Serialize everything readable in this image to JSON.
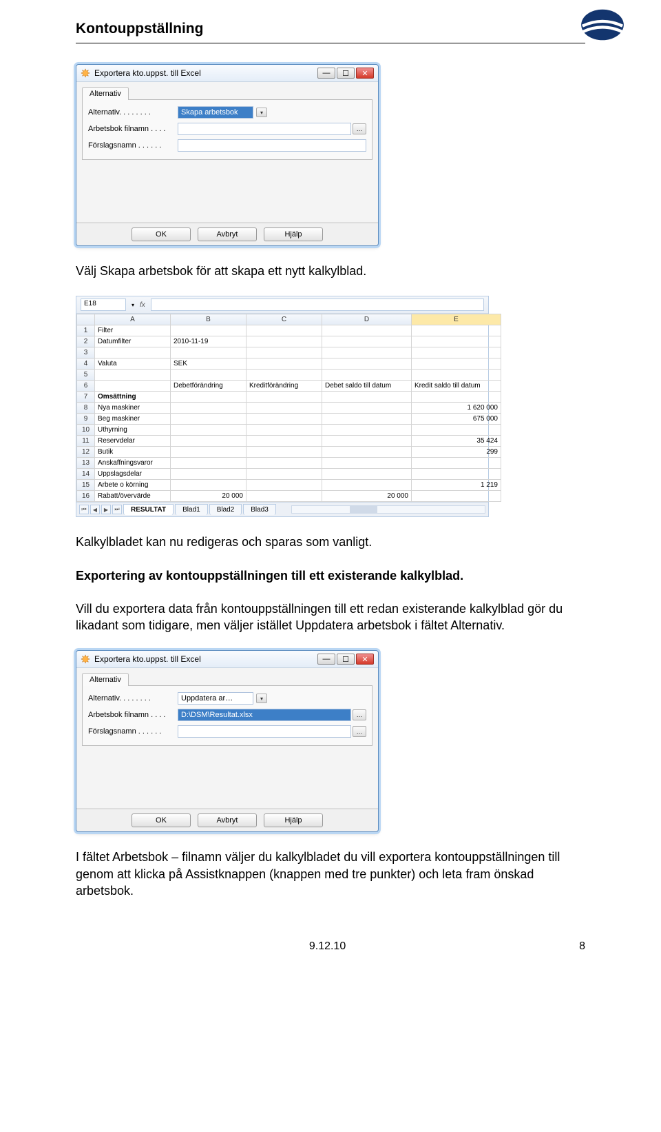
{
  "header": {
    "title": "Kontouppställning"
  },
  "dialog1": {
    "title": "Exportera kto.uppst. till Excel",
    "tab": "Alternativ",
    "rows": {
      "alt_label": "Alternativ. . . . . . . .",
      "alt_value": "Skapa arbetsbok",
      "wb_label": "Arbetsbok filnamn . . . .",
      "wb_value": "",
      "sugg_label": "Förslagsnamn . . . . . .",
      "sugg_value": ""
    },
    "buttons": {
      "ok": "OK",
      "cancel": "Avbryt",
      "help": "Hjälp"
    }
  },
  "para1": "Välj Skapa arbetsbok för att skapa ett nytt kalkylblad.",
  "excel": {
    "cell_ref": "E18",
    "cols": [
      "A",
      "B",
      "C",
      "D",
      "E"
    ],
    "rows": [
      {
        "n": "1",
        "a": "Filter"
      },
      {
        "n": "2",
        "a": "Datumfilter",
        "b": "2010-11-19"
      },
      {
        "n": "3"
      },
      {
        "n": "4",
        "a": "Valuta",
        "b": "SEK"
      },
      {
        "n": "5"
      },
      {
        "n": "6",
        "b": "Debetförändring",
        "c": "Kreditförändring",
        "d": "Debet saldo till datum",
        "e": "Kredit saldo till datum"
      },
      {
        "n": "7",
        "a": "Omsättning",
        "bold": true
      },
      {
        "n": "8",
        "a": "Nya maskiner",
        "e": "1 620 000"
      },
      {
        "n": "9",
        "a": "Beg maskiner",
        "e": "675 000"
      },
      {
        "n": "10",
        "a": "Uthyrning"
      },
      {
        "n": "11",
        "a": "Reservdelar",
        "e": "35 424"
      },
      {
        "n": "12",
        "a": "Butik",
        "e": "299"
      },
      {
        "n": "13",
        "a": "Anskaffningsvaror"
      },
      {
        "n": "14",
        "a": "Uppslagsdelar"
      },
      {
        "n": "15",
        "a": "Arbete o körning",
        "e": "1 219"
      },
      {
        "n": "16",
        "a": "Rabatt/övervärde",
        "b": "20 000",
        "d": "20 000"
      }
    ],
    "sheets": {
      "active": "RESULTAT",
      "others": [
        "Blad1",
        "Blad2",
        "Blad3"
      ]
    }
  },
  "para2": "Kalkylbladet kan nu redigeras och sparas som vanligt.",
  "heading2": "Exportering av kontouppställningen till ett existerande kalkylblad.",
  "para3": "Vill du exportera data från kontouppställningen till ett redan existerande kalkylblad gör du likadant som tidigare, men väljer istället Uppdatera arbetsbok i fältet Alternativ.",
  "dialog2": {
    "title": "Exportera kto.uppst. till Excel",
    "tab": "Alternativ",
    "rows": {
      "alt_label": "Alternativ. . . . . . . .",
      "alt_value": "Uppdatera ar…",
      "wb_label": "Arbetsbok filnamn . . . .",
      "wb_value": "D:\\DSM\\Resultat.xlsx",
      "sugg_label": "Förslagsnamn . . . . . .",
      "sugg_value": ""
    },
    "buttons": {
      "ok": "OK",
      "cancel": "Avbryt",
      "help": "Hjälp"
    }
  },
  "para4": "I fältet Arbetsbok – filnamn väljer du kalkylbladet du vill exportera kontouppställningen till genom att klicka på Assistknappen (knappen med tre punkter) och leta fram önskad arbetsbok.",
  "footer": {
    "date": "9.12.10",
    "page": "8"
  }
}
